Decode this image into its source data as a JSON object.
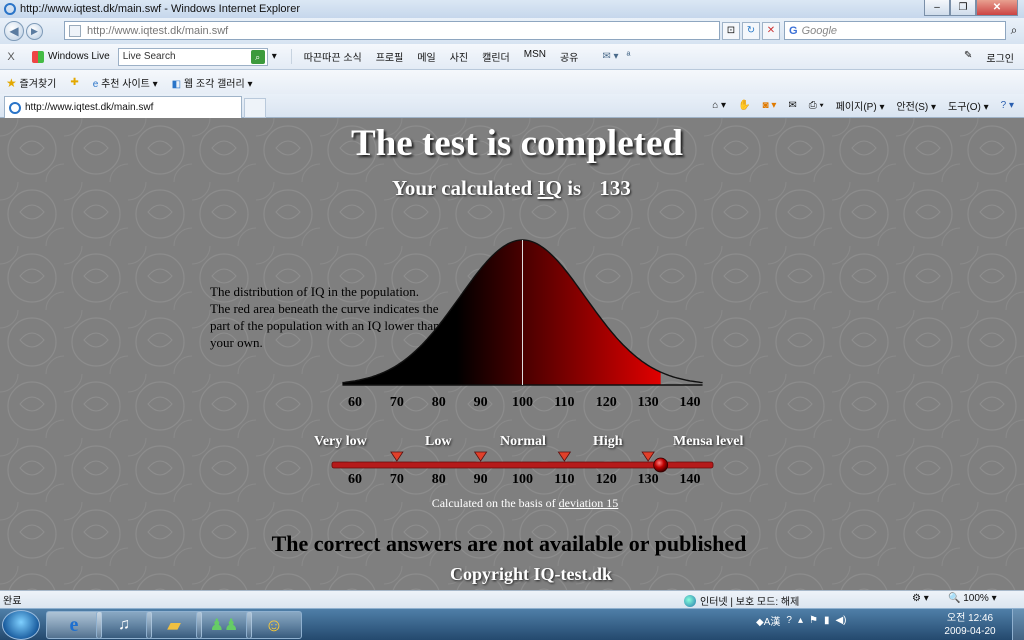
{
  "window": {
    "title": "http://www.iqtest.dk/main.swf - Windows Internet Explorer",
    "url": "http://www.iqtest.dk/main.swf",
    "search_placeholder": "Google",
    "minimize": "‒",
    "maximize": "❐",
    "close": "✕"
  },
  "toolbar": {
    "close_x": "X",
    "windows_live": "Windows Live",
    "live_search_placeholder": "Live Search",
    "links": [
      "따끈따끈 소식",
      "프로필",
      "메일",
      "사진",
      "캘린더",
      "MSN",
      "공유"
    ],
    "login": "로그인"
  },
  "favorites": {
    "label": "즐겨찾기",
    "suggested": "추천 사이트 ▾",
    "gallery": "웹 조각 갤러리 ▾"
  },
  "tab": {
    "label": "http://www.iqtest.dk/main.swf"
  },
  "commands": {
    "page": "페이지(P) ▾",
    "safety": "안전(S) ▾",
    "tools": "도구(O) ▾",
    "help": "? ▾"
  },
  "flash": {
    "title": "The test is completed",
    "iq_prefix": "Your calculated ",
    "iq_word": "IQ",
    "iq_suffix": " is",
    "iq_value": "133",
    "distribution_text": "The distribution of IQ in the population. The red area beneath the curve indicates the part of the population with an IQ lower than your own.",
    "categories": [
      "Very low",
      "Low",
      "Normal",
      "High",
      "Mensa level"
    ],
    "basis_prefix": "Calculated on the basis of ",
    "basis_link": "deviation 15",
    "correct_answers": "The correct answers are not available or published",
    "copyright": "Copyright IQ-test.dk"
  },
  "chart_data": {
    "type": "area",
    "title": "",
    "xlabel": "",
    "ylabel": "",
    "x_ticks": [
      60,
      70,
      80,
      90,
      100,
      110,
      120,
      130,
      140
    ],
    "xlim": [
      60,
      140
    ],
    "mean": 100,
    "std_dev": 15,
    "shaded_below": 133,
    "marker_value": 133,
    "category_boundaries": [
      70,
      90,
      110,
      130
    ],
    "colors": {
      "fill_low": "#000000",
      "fill_high": "#e00000",
      "curve": "#111111",
      "background": "#7f7f7f"
    }
  },
  "statusbar": {
    "left": "완료",
    "zone": "인터넷 | 보호 모드: 해제",
    "zoom": "100%"
  },
  "taskbar": {
    "time": "오전 12:46",
    "date": "2009-04-20"
  }
}
